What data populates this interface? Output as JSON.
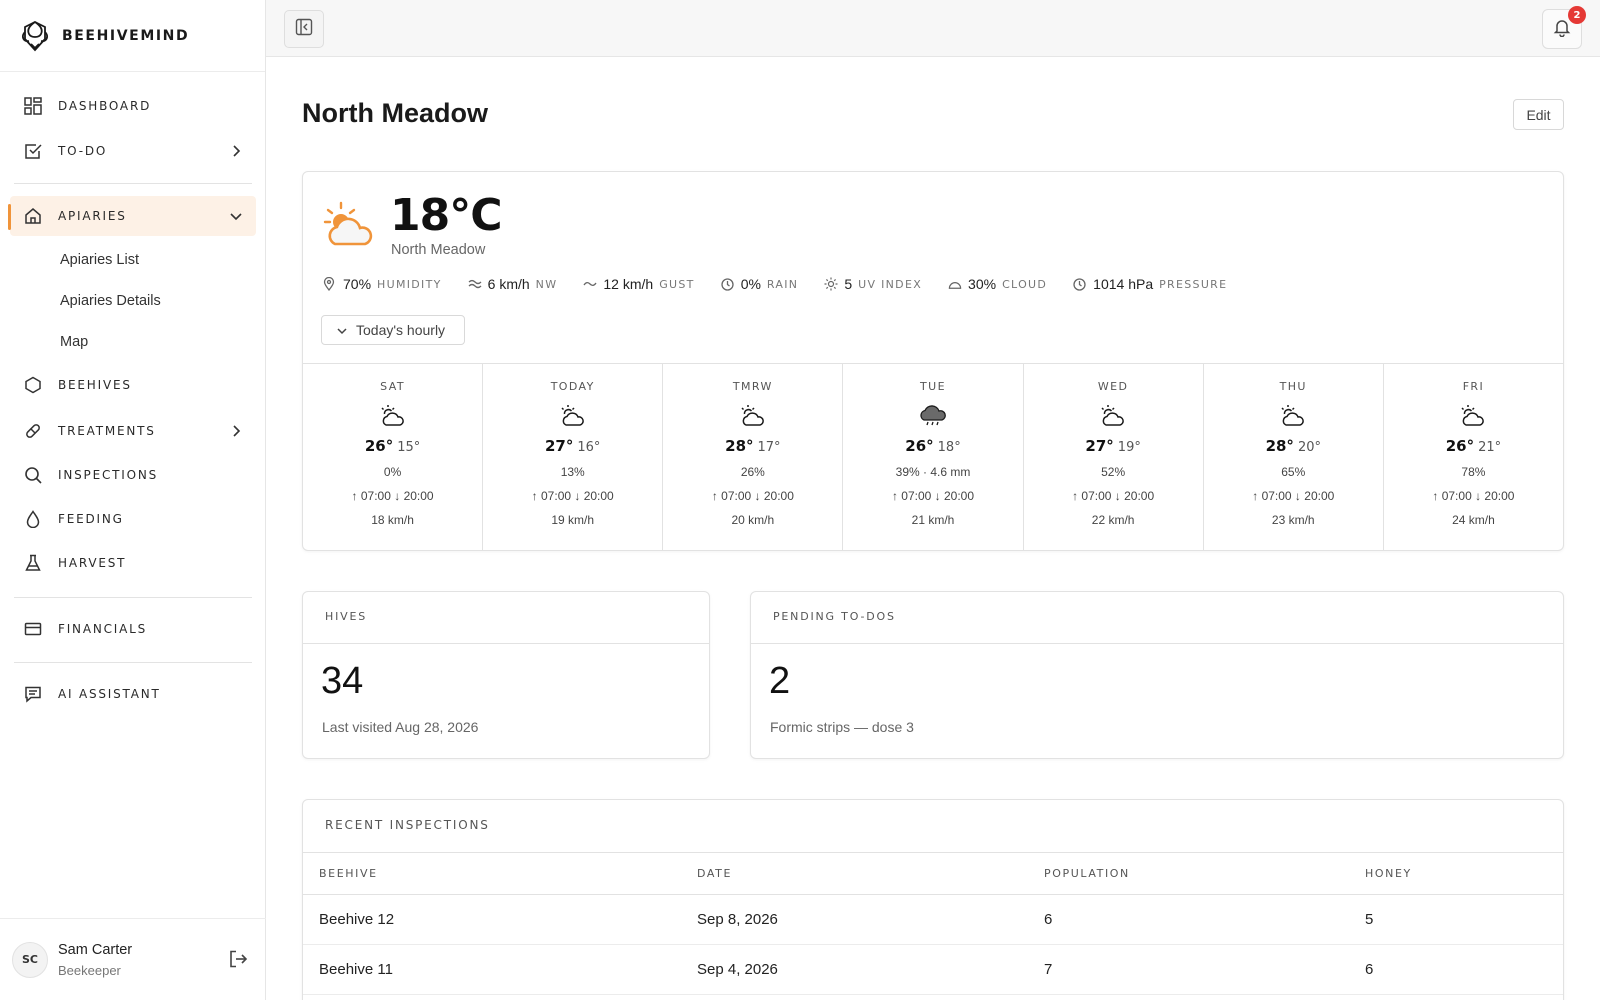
{
  "brand": {
    "name": "BEEHIVEMIND"
  },
  "nav": {
    "dashboard": "DASHBOARD",
    "todo": "TO-DO",
    "apiaries": "APIARIES",
    "apiaries_sub": [
      "Apiaries List",
      "Apiaries Details",
      "Map"
    ],
    "beehives": "BEEHIVES",
    "treatments": "TREATMENTS",
    "inspections": "INSPECTIONS",
    "feeding": "FEEDING",
    "harvest": "HARVEST",
    "financials": "FINANCIALS",
    "ai_assistant": "AI ASSISTANT"
  },
  "user": {
    "initials": "SC",
    "name": "Sam Carter",
    "role": "Beekeeper"
  },
  "topbar": {
    "notification_count": "2"
  },
  "page": {
    "title": "North Meadow",
    "edit_label": "Edit"
  },
  "weather": {
    "temp": "18°C",
    "location": "North Meadow",
    "metrics": [
      {
        "icon": "pin-icon",
        "value": "70%",
        "label": "HUMIDITY"
      },
      {
        "icon": "wind-icon",
        "value": "6 km/h",
        "label": "NW"
      },
      {
        "icon": "gust-icon",
        "value": "12 km/h",
        "label": "GUST"
      },
      {
        "icon": "clock-icon",
        "value": "0%",
        "label": "RAIN"
      },
      {
        "icon": "sun-icon",
        "value": "5",
        "label": "UV INDEX"
      },
      {
        "icon": "cloud-icon",
        "value": "30%",
        "label": "CLOUD"
      },
      {
        "icon": "clock-icon",
        "value": "1014 hPa",
        "label": "PRESSURE"
      }
    ],
    "hourly_label": "Today's hourly",
    "forecast": [
      {
        "day": "SAT",
        "icon": "partly-cloudy-icon",
        "hi": "26°",
        "lo": "15°",
        "rain": "0%",
        "sun": "↑ 07:00 ↓ 20:00",
        "wind": "18 km/h"
      },
      {
        "day": "TODAY",
        "icon": "partly-cloudy-icon",
        "hi": "27°",
        "lo": "16°",
        "rain": "13%",
        "sun": "↑ 07:00 ↓ 20:00",
        "wind": "19 km/h"
      },
      {
        "day": "TMRW",
        "icon": "partly-cloudy-icon",
        "hi": "28°",
        "lo": "17°",
        "rain": "26%",
        "sun": "↑ 07:00 ↓ 20:00",
        "wind": "20 km/h"
      },
      {
        "day": "TUE",
        "icon": "rain-cloud-icon",
        "hi": "26°",
        "lo": "18°",
        "rain": "39% · 4.6 mm",
        "sun": "↑ 07:00 ↓ 20:00",
        "wind": "21 km/h"
      },
      {
        "day": "WED",
        "icon": "partly-cloudy-icon",
        "hi": "27°",
        "lo": "19°",
        "rain": "52%",
        "sun": "↑ 07:00 ↓ 20:00",
        "wind": "22 km/h"
      },
      {
        "day": "THU",
        "icon": "partly-cloudy-icon",
        "hi": "28°",
        "lo": "20°",
        "rain": "65%",
        "sun": "↑ 07:00 ↓ 20:00",
        "wind": "23 km/h"
      },
      {
        "day": "FRI",
        "icon": "partly-cloudy-icon",
        "hi": "26°",
        "lo": "21°",
        "rain": "78%",
        "sun": "↑ 07:00 ↓ 20:00",
        "wind": "24 km/h"
      }
    ]
  },
  "hives": {
    "label": "HIVES",
    "count": "34",
    "sub": "Last visited Aug 28, 2026"
  },
  "todos": {
    "label": "PENDING TO-DOS",
    "count": "2",
    "sub": "Formic strips — dose 3"
  },
  "inspections": {
    "title": "RECENT INSPECTIONS",
    "columns": [
      "BEEHIVE",
      "DATE",
      "POPULATION",
      "HONEY"
    ],
    "rows": [
      [
        "Beehive 12",
        "Sep 8, 2026",
        "6",
        "5"
      ],
      [
        "Beehive 11",
        "Sep 4, 2026",
        "7",
        "6"
      ]
    ]
  },
  "colors": {
    "accent": "#f0943a",
    "active_bg": "#fdf1e6",
    "badge": "#e53935"
  }
}
